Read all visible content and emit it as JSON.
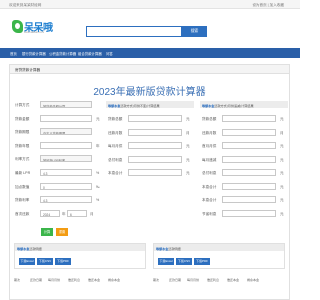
{
  "topbar": {
    "welcome": "欢迎来到呆呆财经网",
    "right": "设为首页 | 加入收藏"
  },
  "logo": {
    "name": "呆呆哦",
    "url": "www.daidaio.com"
  },
  "search": {
    "placeholder": "",
    "button": "搜索"
  },
  "nav": [
    "首页",
    "银行贷款计算器",
    "公积金贷款计算器",
    "组合贷款计算器",
    "问答"
  ],
  "panel": {
    "title": "房贷贷款计算器",
    "heading": "2023年最新版贷款计算器"
  },
  "form": {
    "rows": [
      {
        "label": "计算方式",
        "value": "按贷款金额计算",
        "unit": ""
      },
      {
        "label": "贷款金额",
        "value": "",
        "unit": "元"
      },
      {
        "label": "贷款期限",
        "value": "自定义贷款期限",
        "unit": ""
      },
      {
        "label": "贷款年限",
        "value": "",
        "unit": "年"
      },
      {
        "label": "利率方式",
        "value": "按最新LPR利率",
        "unit": ""
      },
      {
        "label": "最新 LPR",
        "value": "4.3",
        "unit": "%"
      },
      {
        "label": "加点数值",
        "value": "0",
        "unit": "‰"
      },
      {
        "label": "贷款利率",
        "value": "4.3",
        "unit": "%"
      },
      {
        "label": "首次还款",
        "value": "2024",
        "unit": "年"
      }
    ],
    "month_value": "6",
    "month_unit": "月",
    "calc_button": "计算",
    "reset_button": "重置",
    "calc_color": "#3bb54a",
    "reset_color": "#f39c12"
  },
  "results": [
    {
      "head_bold": "等额本息",
      "head_rest": "还款方式(月供不变)计算结果",
      "rows": [
        {
          "label": "贷款总额",
          "unit": "元"
        },
        {
          "label": "还款月数",
          "unit": "月"
        },
        {
          "label": "每月月供",
          "unit": "元"
        },
        {
          "label": "总付利息",
          "unit": "元"
        },
        {
          "label": "本息合计",
          "unit": "元"
        }
      ]
    },
    {
      "head_bold": "等额本金",
      "head_rest": "还款方式(月供递减)计算结果",
      "rows": [
        {
          "label": "贷款总额",
          "unit": "元"
        },
        {
          "label": "还款月数",
          "unit": "月"
        },
        {
          "label": "首月月供",
          "unit": "元"
        },
        {
          "label": "每月递减",
          "unit": "元"
        },
        {
          "label": "总付利息",
          "unit": "元"
        },
        {
          "label": "本息合计",
          "unit": "元"
        },
        {
          "label": "本息合计",
          "unit": "元"
        },
        {
          "label": "节省利息",
          "unit": "元"
        }
      ]
    }
  ],
  "schedules": [
    {
      "head_bold": "等额本息",
      "head_rest": "还款明细",
      "tabs": [
        "下载Excel",
        "下载CSV",
        "下载PDF"
      ]
    },
    {
      "head_bold": "等额本金",
      "head_rest": "还款明细",
      "tabs": [
        "下载Excel",
        "下载CSV",
        "下载PDF"
      ]
    }
  ],
  "table_headers": [
    "期次",
    "还款日期",
    "每月月供",
    "偿还利息",
    "偿还本金",
    "剩余本金",
    "期次",
    "还款日期",
    "每月月供",
    "偿还利息",
    "偿还本金",
    "剩余本金"
  ]
}
